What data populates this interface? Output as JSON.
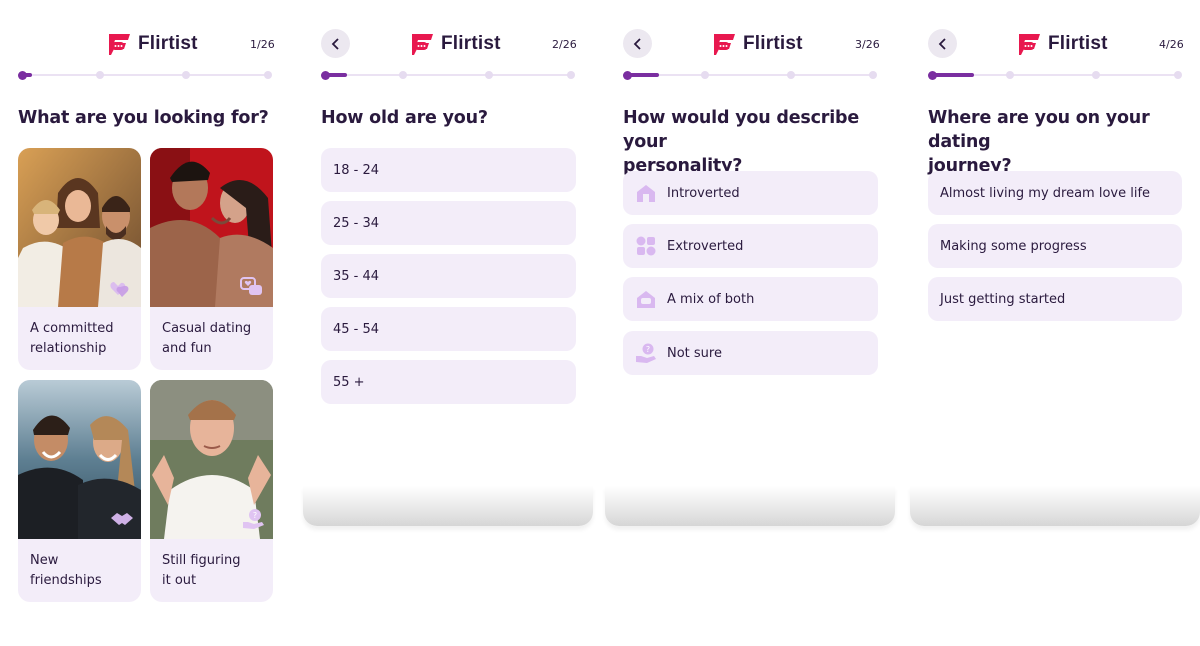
{
  "brand": {
    "name": "Flirtist",
    "color": "#e8184f"
  },
  "accent_color": "#7a2ea0",
  "screens": [
    {
      "step": "1/26",
      "progress": 0.04,
      "question": "What are you looking for?",
      "cards": [
        {
          "label": "A committed relationship",
          "line1": "A committed",
          "line2": "relationship",
          "badge": "hearts-icon"
        },
        {
          "label": "Casual dating and fun",
          "line1": "Casual dating",
          "line2": "and fun",
          "badge": "chat-heart-icon"
        },
        {
          "label": "New friendships",
          "line1": "New",
          "line2": "friendships",
          "badge": "handshake-icon"
        },
        {
          "label": "Still figuring it out",
          "line1": "Still figuring",
          "line2": "it out",
          "badge": "question-hand-icon"
        }
      ]
    },
    {
      "step": "2/26",
      "progress": 0.08,
      "question": "How old are you?",
      "options": [
        "18 - 24",
        "25 - 34",
        "35 - 44",
        "45 - 54",
        "55 +"
      ]
    },
    {
      "step": "3/26",
      "progress": 0.12,
      "question_line1": "How would you describe your",
      "question_line2": "personality?",
      "options": [
        {
          "label": "Introverted",
          "icon": "house-icon"
        },
        {
          "label": "Extroverted",
          "icon": "shapes-icon"
        },
        {
          "label": "A mix of both",
          "icon": "house-chat-icon"
        },
        {
          "label": "Not sure",
          "icon": "question-hand-icon"
        }
      ]
    },
    {
      "step": "4/26",
      "progress": 0.16,
      "question_line1": "Where are you on your dating",
      "question_line2": "journey?",
      "options": [
        "Almost living my dream love life",
        "Making some progress",
        "Just getting started"
      ]
    }
  ]
}
